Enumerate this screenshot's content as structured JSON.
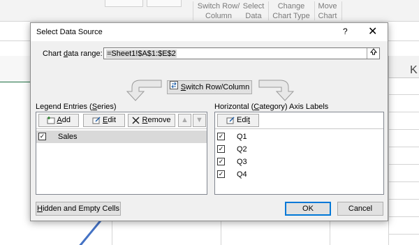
{
  "ribbon": {
    "switch_row_column": [
      "Switch Row/",
      "Column"
    ],
    "select_data": [
      "Select",
      "Data"
    ],
    "change_chart_type": [
      "Change",
      "Chart Type"
    ],
    "move_chart": [
      "Move",
      "Chart"
    ]
  },
  "sheet": {
    "column_header": "K"
  },
  "dialog": {
    "title": "Select Data Source",
    "help": "?",
    "close": "✕",
    "range_label_pre": "Chart ",
    "range_label_u": "d",
    "range_label_post": "ata range:",
    "range_value": "=Sheet1!$A$1:$E$2",
    "switch_pre": "",
    "switch_u": "S",
    "switch_post": "witch Row/Column",
    "legend": {
      "title_pre": "Legend Entries (",
      "title_u": "S",
      "title_post": "eries)",
      "add_u": "A",
      "add_post": "dd",
      "edit_u": "E",
      "edit_post": "dit",
      "remove_u": "R",
      "remove_post": "emove",
      "items": [
        {
          "label": "Sales",
          "checked": true
        }
      ]
    },
    "axis": {
      "title_pre": "Horizontal (",
      "title_u": "C",
      "title_post": "ategory) Axis Labels",
      "edit_pre": "Edi",
      "edit_u": "t",
      "items": [
        "Q1",
        "Q2",
        "Q3",
        "Q4"
      ]
    },
    "hidden_pre": "",
    "hidden_u": "H",
    "hidden_post": "idden and Empty Cells",
    "ok": "OK",
    "cancel": "Cancel"
  }
}
